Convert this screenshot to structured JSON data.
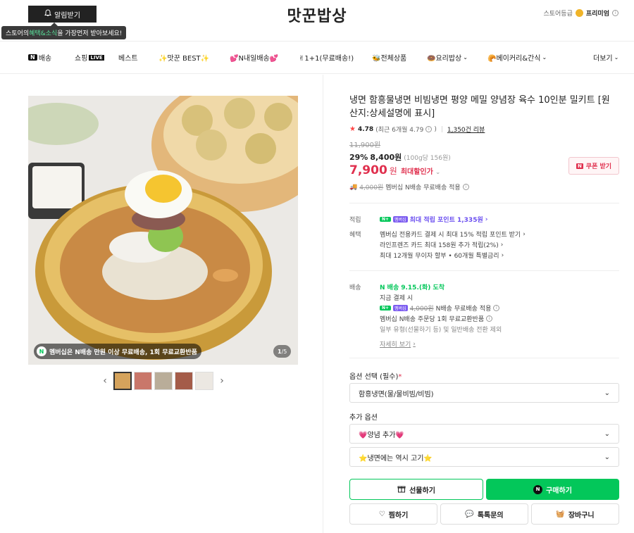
{
  "header": {
    "alarm_label": "알림받기",
    "tooltip_pre": "스토어의 ",
    "tooltip_highlight": "혜택&소식",
    "tooltip_post": "을 가장먼저 받아보세요!",
    "store_name": "맛꾼밥상",
    "grade_label": "스토어등급",
    "grade_value": "프리미엄"
  },
  "nav": {
    "items": [
      {
        "label": "배송",
        "badge": "N"
      },
      {
        "label": "쇼핑",
        "badge": "LIVE"
      },
      {
        "label": "베스트"
      },
      {
        "label": "✨맛꾼 BEST✨"
      },
      {
        "label": "💕N내일배송💕"
      },
      {
        "label": "✌1+1(무료배송!)"
      },
      {
        "label": "🐝전체상품"
      },
      {
        "label": "🍩요리밥상"
      },
      {
        "label": "🥐베이커리&간식"
      },
      {
        "label": "더보기"
      }
    ]
  },
  "gallery": {
    "caption": "멤버십은 N배송 만원 이상 무료배송, 1회 무료교환반품",
    "caption_icon": "N",
    "counter_current": "1",
    "counter_total": "/5",
    "thumb_count": 5
  },
  "product": {
    "title": "냉면 함흥물냉면 비빔냉면 평양 메밀 양념장 육수 10인분 밀키트 [원산지:상세설명에 표시]",
    "rating": "4.78",
    "rating_recent": "(최근 6개월 4.79",
    "review_count": "1,350건 리뷰",
    "original_price": "11,900원",
    "discount_rate": "29%",
    "sale_price": "8,400원",
    "unit_price": "(100g당 156원)",
    "max_discount_price": "7,900",
    "won": "원",
    "max_discount_label": "최대할인가",
    "coupon_label": "쿠폰 받기",
    "ship_fee_old": "4,000원",
    "ship_note": "멤버십 N배송 무료배송 적용"
  },
  "benefits": {
    "points_label": "적립",
    "points_text": "최대 적립 포인트 1,335원",
    "perks_label": "혜택",
    "perks": [
      "멤버십 전용카드 결제 시 최대 15% 적립 포인트 받기",
      "라인프렌즈 카드 최대 158원 추가 적립(2%)",
      "최대 12개월 무이자 할부 • 60개월 특별금리"
    ]
  },
  "delivery": {
    "label": "배송",
    "badge": "N 배송",
    "arrival": "9.15.(화) 도착",
    "pay_now": "지금 결제 시",
    "fee_old": "4,000원",
    "fee_text": "N배송 무료배송 적용",
    "exchange": "멤버십 N배송 주문당 1회 무료교환반품",
    "exclusion": "일부 유형(선물하기 등) 및 일반배송 전환 제외",
    "more": "자세히 보기"
  },
  "options": {
    "required_title": "옵션 선택 (필수)",
    "required_value": "함흥냉면(물/물비빔/비빔)",
    "extra_title": "추가 옵션",
    "extra_1": "💗양념 추가💗",
    "extra_2": "⭐냉면에는 역시 고기⭐"
  },
  "actions": {
    "gift": "선물하기",
    "buy": "구매하기",
    "wish": "찜하기",
    "talk": "톡톡문의",
    "cart": "장바구니"
  },
  "colors": {
    "accent_green": "#03c75a",
    "price_red": "#e0304e",
    "points_purple": "#6b4ff0"
  }
}
